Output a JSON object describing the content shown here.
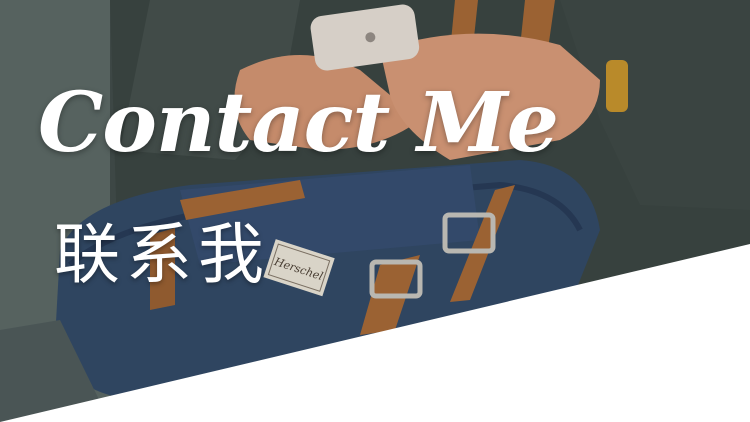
{
  "hero": {
    "title": "Contact Me",
    "subtitle": "联系我",
    "label_text": "Herschel"
  },
  "colors": {
    "backpack": "#2f4560",
    "strap": "#9b6233",
    "sleeve": "#3a4541",
    "skin": "#c58b6b",
    "phone": "#d6cfc7",
    "white_panel": "#ffffff"
  }
}
